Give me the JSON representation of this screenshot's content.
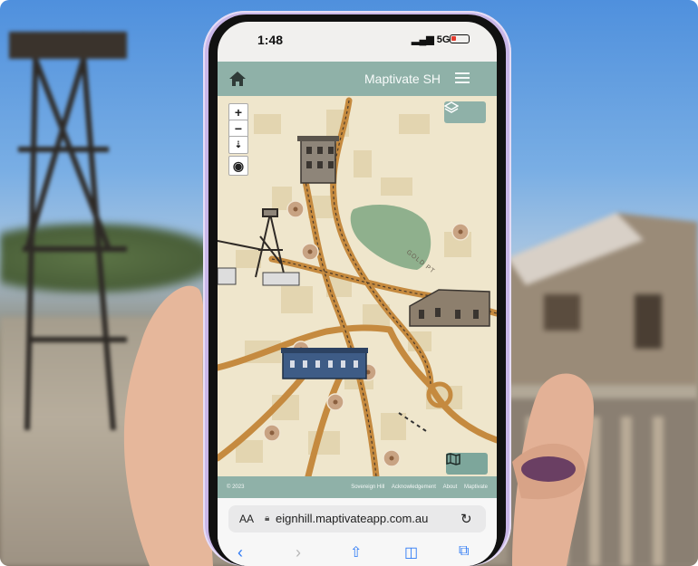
{
  "status_bar": {
    "time": "1:48",
    "signal": "5G"
  },
  "app": {
    "title": "Maptivate SH"
  },
  "map": {
    "street_label": "GOLD PT"
  },
  "footer": {
    "copyright": "© 2023",
    "links": [
      "Sovereign Hill",
      "Acknowledgement",
      "About",
      "Maptivate"
    ]
  },
  "browser": {
    "text_size_label": "AA",
    "url": "eignhill.maptivateapp.com.au"
  },
  "icons": [
    "home-icon",
    "menu-icon",
    "zoom-in-icon",
    "zoom-out-icon",
    "compass-icon",
    "locate-icon",
    "layers-icon",
    "map-icon",
    "lock-icon",
    "reload-icon",
    "back-icon",
    "forward-icon",
    "share-icon",
    "bookmarks-icon",
    "tabs-icon"
  ],
  "colors": {
    "header": "#8fb1a8",
    "map_bg": "#efe6cc",
    "road": "#c58a3f",
    "marker": "#c8a383",
    "lake": "#8fb08d",
    "phone_case": "#c9b7e8"
  }
}
